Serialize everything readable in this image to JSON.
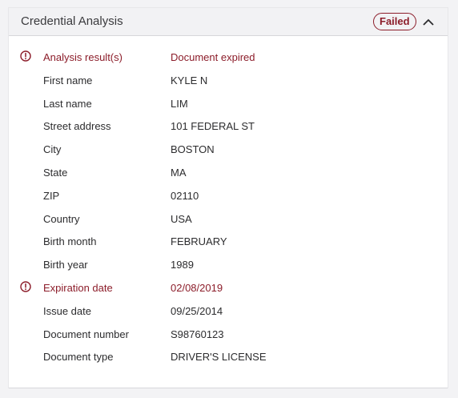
{
  "header": {
    "title": "Credential Analysis",
    "status": "Failed",
    "status_color": "#8c1d2a",
    "collapse_icon": "chevron-up-icon"
  },
  "rows": [
    {
      "label": "Analysis result(s)",
      "value": "Document expired",
      "error": true
    },
    {
      "label": "First name",
      "value": "KYLE N",
      "error": false
    },
    {
      "label": "Last name",
      "value": "LIM",
      "error": false
    },
    {
      "label": "Street address",
      "value": "101 FEDERAL ST",
      "error": false
    },
    {
      "label": "City",
      "value": "BOSTON",
      "error": false
    },
    {
      "label": "State",
      "value": "MA",
      "error": false
    },
    {
      "label": "ZIP",
      "value": "02110",
      "error": false
    },
    {
      "label": "Country",
      "value": "USA",
      "error": false
    },
    {
      "label": "Birth month",
      "value": "FEBRUARY",
      "error": false
    },
    {
      "label": "Birth year",
      "value": "1989",
      "error": false
    },
    {
      "label": "Expiration date",
      "value": "02/08/2019",
      "error": true
    },
    {
      "label": "Issue date",
      "value": "09/25/2014",
      "error": false
    },
    {
      "label": "Document number",
      "value": "S98760123",
      "error": false
    },
    {
      "label": "Document type",
      "value": "DRIVER'S LICENSE",
      "error": false
    }
  ],
  "error_icon": "alert-circle-icon"
}
